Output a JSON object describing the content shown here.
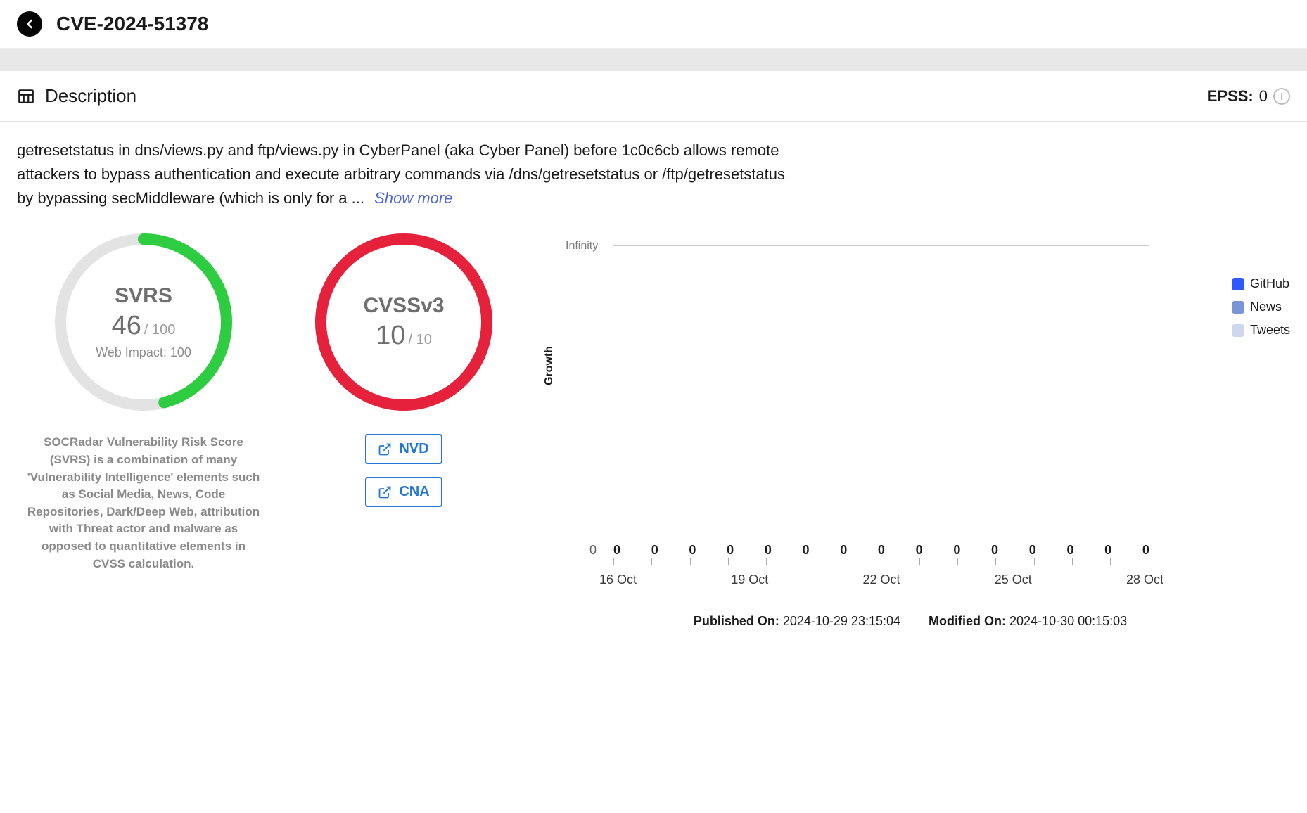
{
  "header": {
    "title": "CVE-2024-51378"
  },
  "section": {
    "title": "Description",
    "epss_label": "EPSS:",
    "epss_value": "0"
  },
  "description": {
    "text": "getresetstatus in dns/views.py and ftp/views.py in CyberPanel (aka Cyber Panel) before 1c0c6cb allows remote attackers to bypass authentication and execute arbitrary commands via /dns/getresetstatus or /ftp/getresetstatus by bypassing secMiddleware (which is only for a ...",
    "show_more": "Show more"
  },
  "svrs": {
    "label": "SVRS",
    "value": "46",
    "max": "/ 100",
    "sub": "Web Impact: 100",
    "percent": 46,
    "color": "#2ecc40",
    "desc": "SOCRadar Vulnerability Risk Score (SVRS) is a combination of many 'Vulnerability Intelligence' elements such as Social Media, News, Code Repositories, Dark/Deep Web, attribution with Threat actor and malware as opposed to quantitative elements in CVSS calculation."
  },
  "cvss": {
    "label": "CVSSv3",
    "value": "10",
    "max": "/ 10",
    "percent": 100,
    "color": "#e6213c",
    "links": [
      {
        "label": "NVD"
      },
      {
        "label": "CNA"
      }
    ]
  },
  "chart_data": {
    "type": "line",
    "title": "",
    "ylabel": "Growth",
    "xlabel": "",
    "ylim_labels": [
      "0",
      "Infinity"
    ],
    "x_ticks": [
      "16 Oct",
      "19 Oct",
      "22 Oct",
      "25 Oct",
      "28 Oct"
    ],
    "series": [
      {
        "name": "GitHub",
        "color": "#2e59ff",
        "values": [
          0,
          0,
          0,
          0,
          0,
          0,
          0,
          0,
          0,
          0,
          0,
          0,
          0,
          0,
          0
        ]
      },
      {
        "name": "News",
        "color": "#7a94d6",
        "values": [
          0,
          0,
          0,
          0,
          0,
          0,
          0,
          0,
          0,
          0,
          0,
          0,
          0,
          0,
          0
        ]
      },
      {
        "name": "Tweets",
        "color": "#cfd7ee",
        "values": [
          0,
          0,
          0,
          0,
          0,
          0,
          0,
          0,
          0,
          0,
          0,
          0,
          0,
          0,
          0
        ]
      }
    ],
    "data_point_labels": [
      "0",
      "0",
      "0",
      "0",
      "0",
      "0",
      "0",
      "0",
      "0",
      "0",
      "0",
      "0",
      "0",
      "0",
      "0"
    ]
  },
  "timestamps": {
    "published_label": "Published On:",
    "published_value": "2024-10-29 23:15:04",
    "modified_label": "Modified On:",
    "modified_value": "2024-10-30 00:15:03"
  }
}
